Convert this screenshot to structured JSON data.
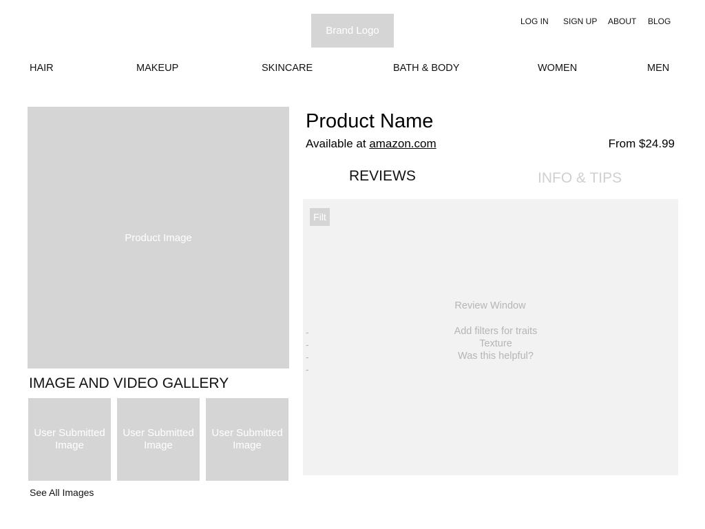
{
  "header": {
    "brand_logo": "Brand Logo",
    "links": {
      "login": "LOG IN",
      "signup": "SIGN UP",
      "about": "ABOUT",
      "blog": "BLOG"
    }
  },
  "nav": {
    "categories": {
      "hair": "HAIR",
      "makeup": "MAKEUP",
      "skincare": "SKINCARE",
      "bath_body": "BATH & BODY",
      "women": "WOMEN",
      "men": "MEN"
    }
  },
  "product": {
    "image_label": "Product Image",
    "name": "Product Name",
    "availability_prefix": "Available at ",
    "retailer": "amazon.com",
    "price": "From $24.99"
  },
  "gallery": {
    "title": "IMAGE AND VIDEO GALLERY",
    "thumbs": [
      {
        "line1": "User Submitted",
        "line2": "Image"
      },
      {
        "line1": "User Submitted",
        "line2": "Image"
      },
      {
        "line1": "User Submitted",
        "line2": "Image"
      }
    ],
    "see_all": "See All Images"
  },
  "tabs": {
    "reviews": "REVIEWS",
    "info_tips": "INFO & TIPS"
  },
  "reviews": {
    "filter_label": "Filt",
    "window_title": "Review Window",
    "lines": [
      "Add filters for traits",
      "Texture",
      "Was this helpful?"
    ],
    "dashes": [
      "-",
      "-",
      "-",
      "-"
    ]
  }
}
